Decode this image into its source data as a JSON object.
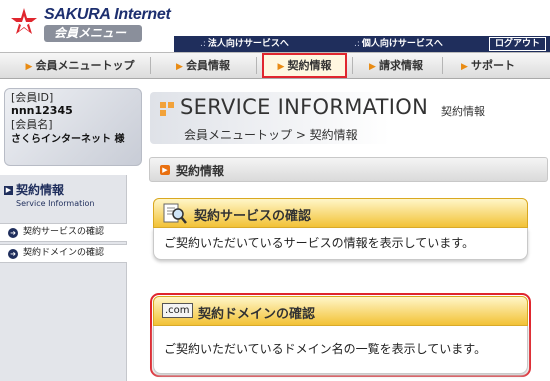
{
  "header": {
    "brand": "SAKURA Internet",
    "subtitle": "会員メニュー",
    "links": [
      "法人向けサービスへ",
      "個人向けサービスへ"
    ],
    "logout": "ログアウト"
  },
  "nav": {
    "tabs": [
      "会員メニュートップ",
      "会員情報",
      "契約情報",
      "請求情報",
      "サポート"
    ],
    "active": "契約情報"
  },
  "member": {
    "id_label": "[会員ID]",
    "id": "nnn12345",
    "name_label": "[会員名]",
    "name": "さくらインターネット 様"
  },
  "sidebar": {
    "title": "契約情報",
    "title_en": "Service Information",
    "items": [
      "契約サービスの確認",
      "契約ドメインの確認"
    ]
  },
  "main": {
    "title": "SERVICE INFORMATION",
    "title_jp": "契約情報",
    "breadcrumb": "会員メニュートップ > 契約情報",
    "section": "契約情報",
    "cards": [
      {
        "title": "契約サービスの確認",
        "text": "ご契約いただいているサービスの情報を表示しています。"
      },
      {
        "title": "契約ドメインの確認",
        "badge": ".com",
        "text": "ご契約いただいているドメイン名の一覧を表示しています。"
      }
    ]
  },
  "colors": {
    "navy": "#1f2e5c",
    "accent": "#e98b13",
    "highlight": "#e0262e",
    "card_header": "#f2c236"
  }
}
